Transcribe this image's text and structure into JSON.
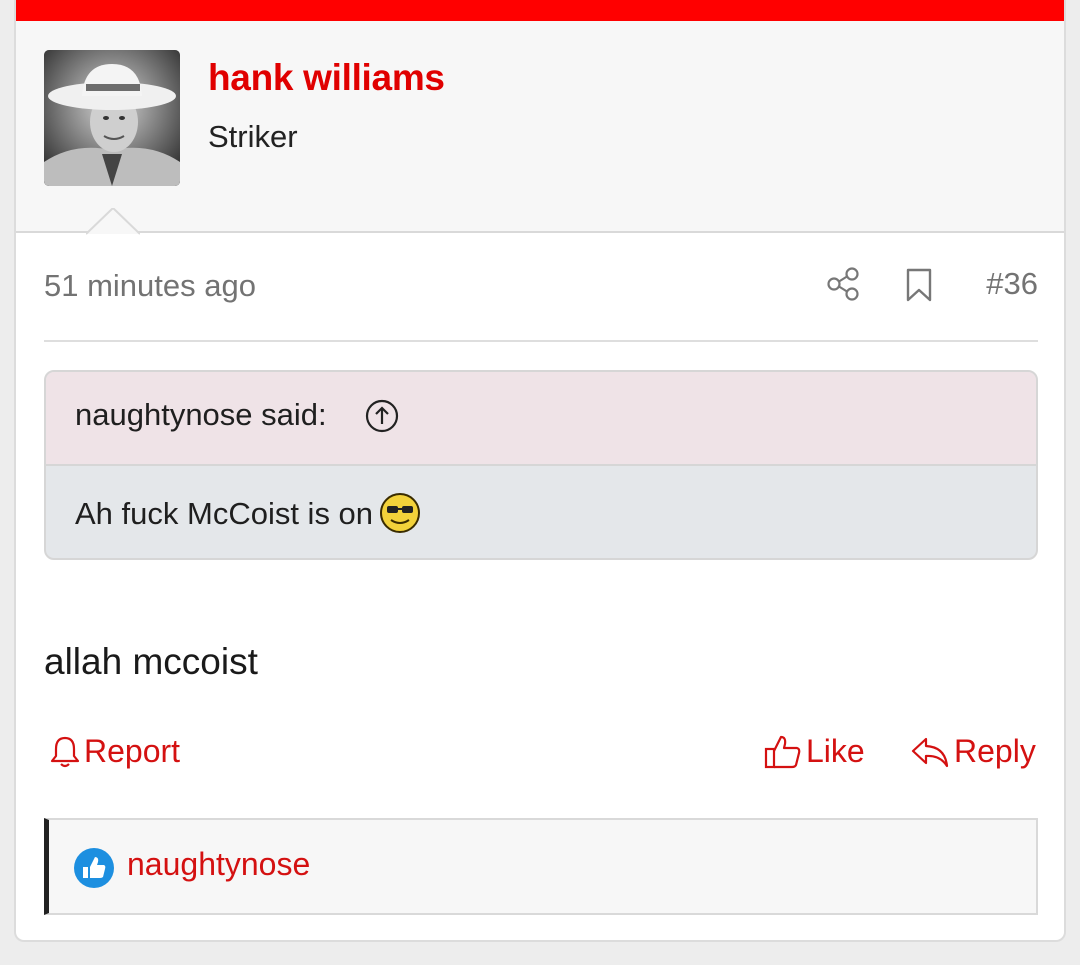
{
  "theme": {
    "accent": "#ff0000",
    "link_red": "#d41111",
    "quote_header_bg": "#efe3e7",
    "quote_body_bg": "#e4e7ea"
  },
  "post": {
    "author": {
      "name": "hank williams",
      "title": "Striker",
      "avatar_icon": "avatar-photo"
    },
    "timestamp": "51 minutes ago",
    "post_number": "#36",
    "quote": {
      "author_said": "naughtynose said:",
      "text": "Ah fuck McCoist is on",
      "emoji_icon": "cool-sunglasses-smiley-icon"
    },
    "message": "allah mccoist",
    "actions": {
      "report_label": "Report",
      "like_label": "Like",
      "reply_label": "Reply"
    },
    "likes": {
      "icon": "thumbs-up-badge-icon",
      "users": "naughtynose"
    }
  }
}
